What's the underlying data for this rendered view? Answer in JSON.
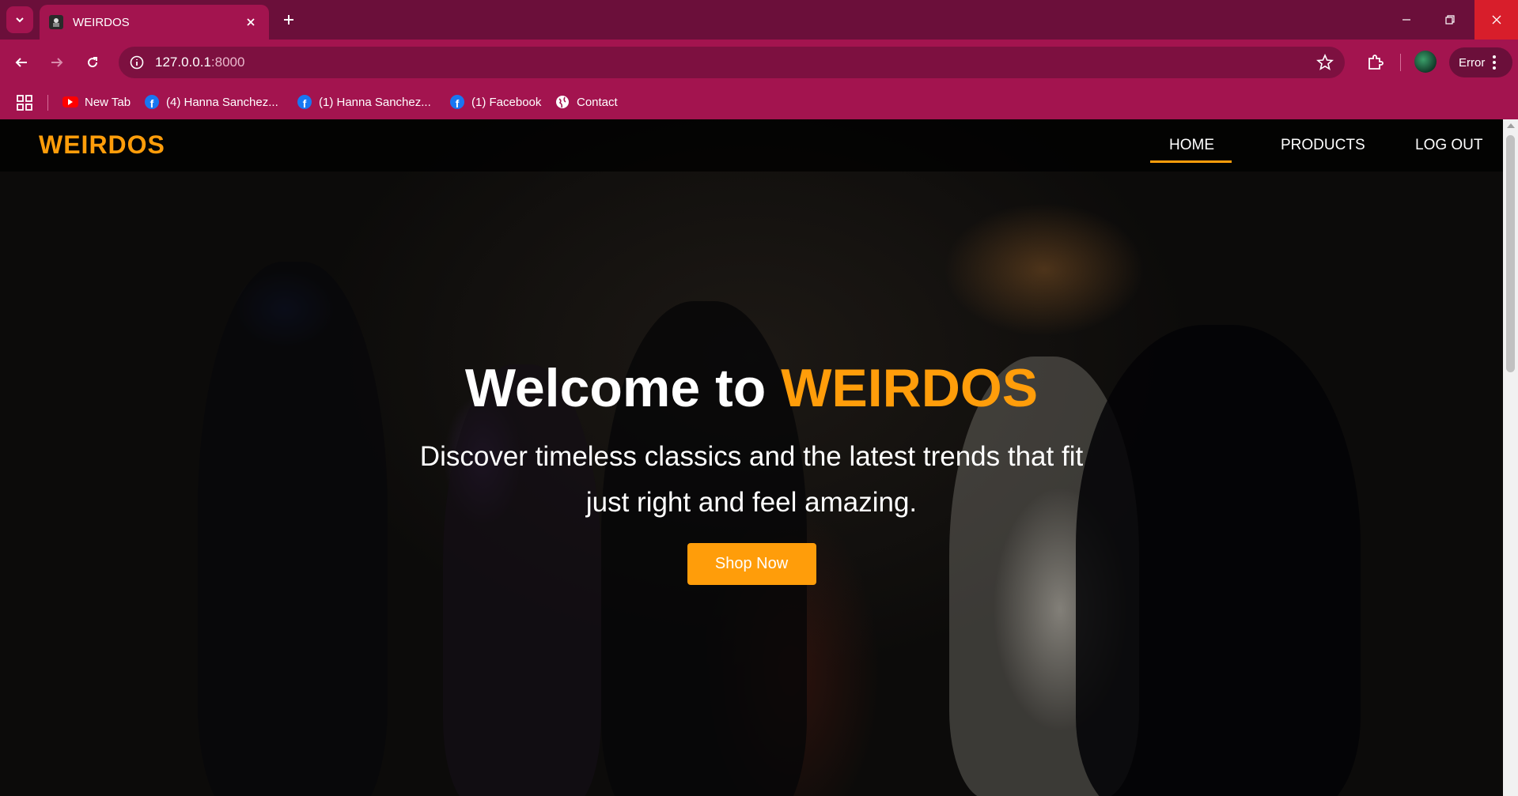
{
  "browser": {
    "tab_title": "WEIRDOS",
    "url_host": "127.0.0.1",
    "url_port": ":8000",
    "profile_status": "Error",
    "bookmarks": [
      {
        "label": "New Tab",
        "icon": "youtube-icon"
      },
      {
        "label": "(4) Hanna Sanchez...",
        "icon": "facebook-icon"
      },
      {
        "label": "(1) Hanna Sanchez...",
        "icon": "facebook-icon"
      },
      {
        "label": "(1) Facebook",
        "icon": "facebook-icon"
      },
      {
        "label": "Contact",
        "icon": "globe-icon"
      }
    ]
  },
  "site": {
    "logo": "WEIRDOS",
    "nav": [
      {
        "label": "HOME",
        "active": true
      },
      {
        "label": "PRODUCTS",
        "active": false
      },
      {
        "label": "LOG OUT",
        "active": false
      }
    ],
    "hero": {
      "heading_prefix": "Welcome to ",
      "heading_brand": "WEIRDOS",
      "subtitle": "Discover timeless classics and the latest trends that fit just right and feel amazing.",
      "cta": "Shop Now"
    }
  },
  "colors": {
    "accent": "#ff9d0a",
    "chrome": "#a3144f",
    "chrome_dark": "#6b0f3a"
  }
}
